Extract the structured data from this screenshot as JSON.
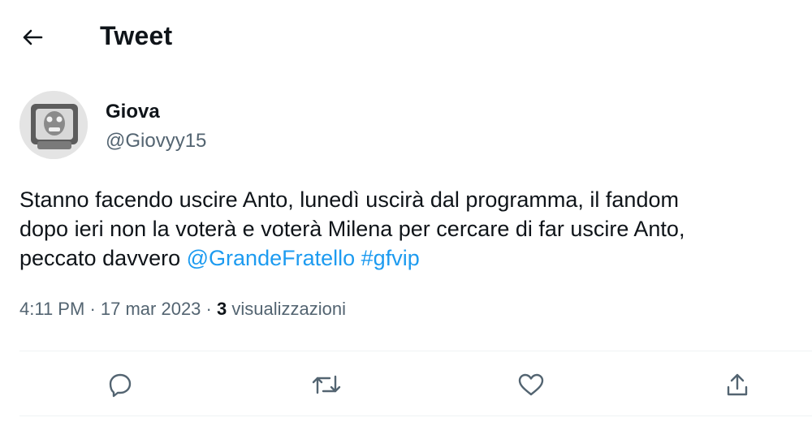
{
  "header": {
    "title": "Tweet",
    "back_icon": "arrow-left-icon"
  },
  "author": {
    "display_name": "Giova",
    "handle": "@Giovyy15",
    "avatar_icon": "avatar-image"
  },
  "tweet": {
    "line1": "Stanno facendo uscire Anto, lunedì uscirà dal programma, il fandom",
    "line2": "dopo ieri non la voterà e voterà Milena per cercare di far uscire Anto,",
    "line3_text": "peccato davvero",
    "mention": "@GrandeFratello",
    "hashtag": "#gfvip"
  },
  "meta": {
    "time": "4:11 PM",
    "separator": "·",
    "date": "17 mar 2023",
    "views_count": "3",
    "views_label": "visualizzazioni"
  },
  "actions": {
    "reply_icon": "reply-icon",
    "retweet_icon": "retweet-icon",
    "like_icon": "heart-icon",
    "share_icon": "share-icon"
  },
  "colors": {
    "link": "#1d9bf0",
    "text": "#0f1419",
    "secondary": "#536471",
    "divider": "#eff3f4"
  }
}
